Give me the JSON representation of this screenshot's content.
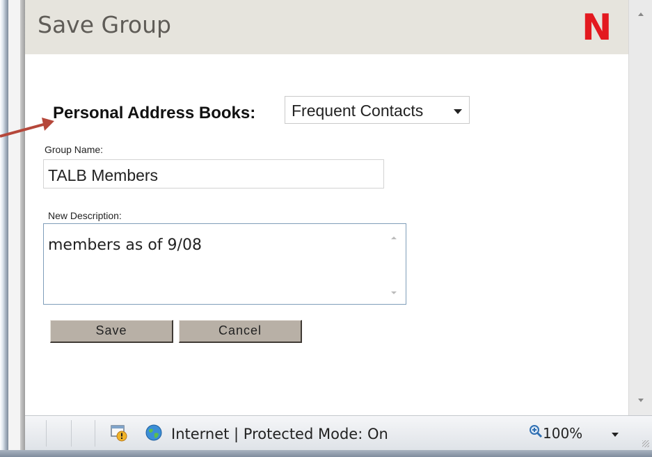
{
  "dialog": {
    "title": "Save Group",
    "logo_text": "N",
    "logo_color": "#e3191f"
  },
  "form": {
    "address_book_label": "Personal Address Books:",
    "address_book_selected": "Frequent Contacts",
    "group_name_label": "Group Name:",
    "group_name_value": "TALB Members",
    "description_label": "New Description:",
    "description_value": "members as of 9/08"
  },
  "buttons": {
    "save_label": "Save",
    "cancel_label": "Cancel"
  },
  "statusbar": {
    "zone_text": "Internet | Protected Mode: On",
    "zoom_text": "100%"
  },
  "annotation": {
    "arrow_color": "#b5473a"
  },
  "icons": [
    "logo-n",
    "select-chevron-down-icon",
    "scroll-up-icon",
    "scroll-down-icon",
    "protected-mode-warning-icon",
    "globe-icon",
    "zoom-icon",
    "zoom-chevron-down-icon"
  ]
}
